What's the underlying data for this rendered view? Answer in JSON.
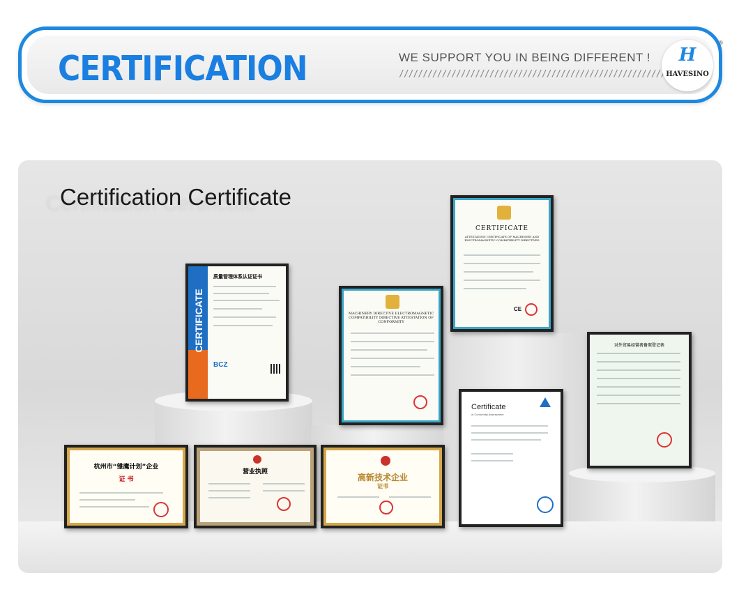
{
  "banner": {
    "title": "CERTIFICATION",
    "tagline": "WE SUPPORT YOU IN BEING DIFFERENT !",
    "slashes": "////////////////////////////////////////////////////////",
    "logo_text": "HAVESINO",
    "logo_mark": "H",
    "logo_reg": "®"
  },
  "scene": {
    "title": "Certification Certificate"
  },
  "certificates": {
    "quality": {
      "side": "CERTIFICATE",
      "heading": "质量管理体系认证证书",
      "brand": "BCZ"
    },
    "ce_top": {
      "heading": "CERTIFICATE",
      "sub": "ATTESTATION CERTIFICATE OF MACHINERY AND ELECTROMAGNETIC COMPATIBILITY DIRECTIVES"
    },
    "ce_mid": {
      "heading": "MACHINERY DIRECTIVE ELECTROMAGNETIC COMPATIBILITY DIRECTIVE ATTESTATION OF CONFORMITY"
    },
    "hangzhou": {
      "heading": "杭州市“雏鹰计划”企业",
      "sub": "证 书"
    },
    "license": {
      "heading": "营业执照"
    },
    "hitech": {
      "heading": "高新技术企业",
      "sub": "证书"
    },
    "conformity": {
      "heading": "Certificate",
      "sub": "of Conformity Assessment"
    },
    "trade": {
      "heading": "对外贸易经营者备案登记表"
    }
  },
  "colors": {
    "accent": "#1e88e0",
    "orange": "#e86a1e",
    "frame": "#222222"
  }
}
